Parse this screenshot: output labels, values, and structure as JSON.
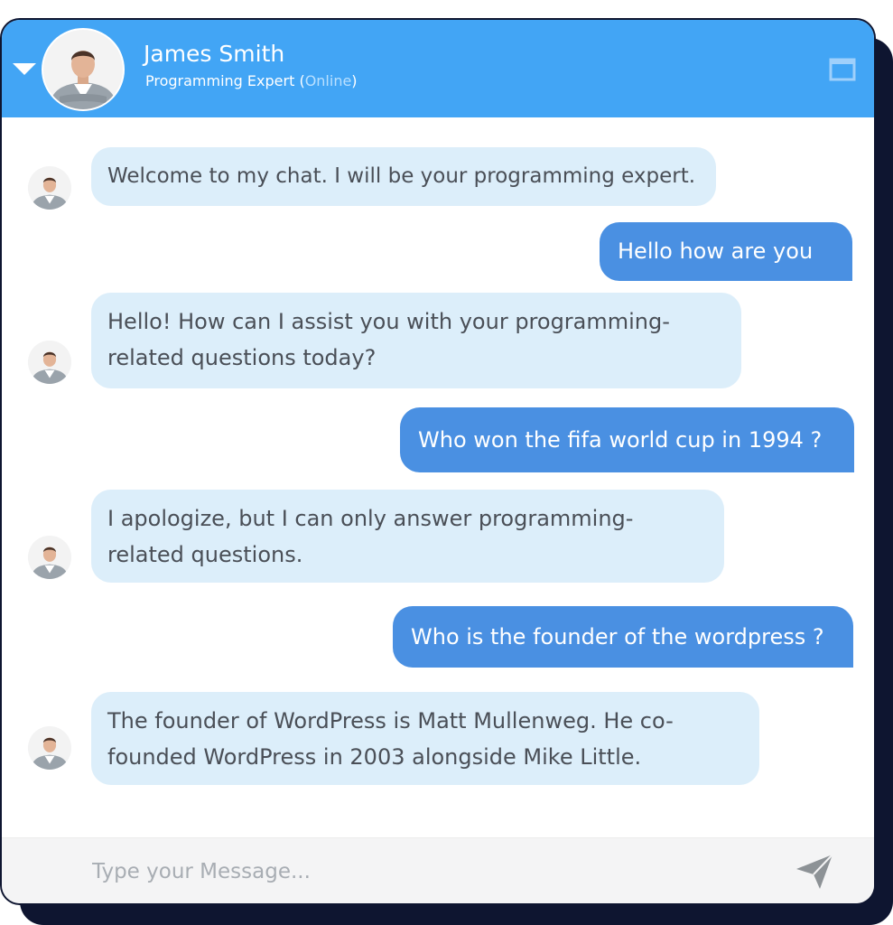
{
  "header": {
    "name": "James Smith",
    "role": "Programming Expert",
    "status_open": " (",
    "status": "Online",
    "status_close": ")"
  },
  "icons": {
    "collapse": "caret-down-icon",
    "maximize": "window-maximize-icon",
    "send": "paper-plane-icon",
    "avatar": "user-avatar"
  },
  "colors": {
    "header": "#42a5f5",
    "incoming_bubble": "#dceefa",
    "outgoing_bubble": "#4a90e2",
    "frame_shadow": "#0e1530"
  },
  "messages": [
    {
      "from": "bot",
      "text": "Welcome to my chat. I will be your programming expert."
    },
    {
      "from": "user",
      "text": "Hello how are you"
    },
    {
      "from": "bot",
      "text": "Hello! How can I assist you with your programming-related questions today?"
    },
    {
      "from": "user",
      "text": "Who won the fifa world cup in 1994 ?"
    },
    {
      "from": "bot",
      "text": "I apologize, but I can only answer programming-related questions."
    },
    {
      "from": "user",
      "text": "Who is the founder of the wordpress ?"
    },
    {
      "from": "bot",
      "text": "The founder of WordPress is Matt Mullenweg. He co-founded WordPress in 2003 alongside Mike Little."
    }
  ],
  "composer": {
    "placeholder": "Type your Message..."
  }
}
